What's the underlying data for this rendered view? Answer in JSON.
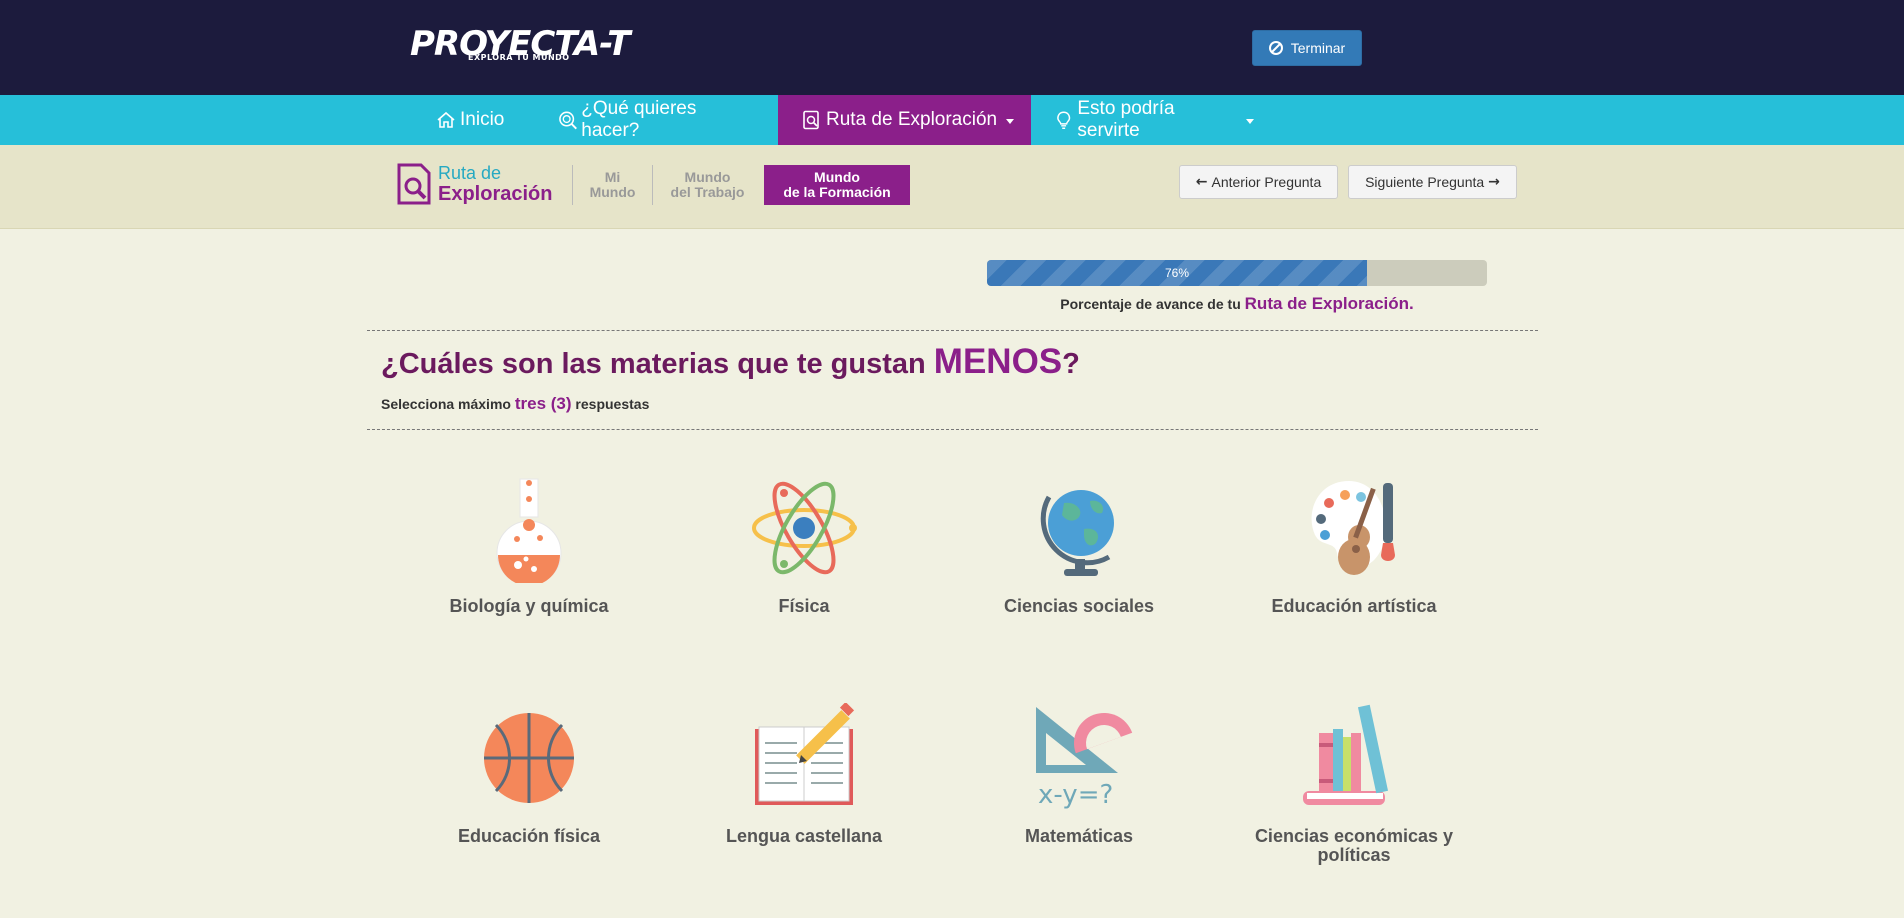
{
  "header": {
    "brand": "PROYECTA-T",
    "tagline": "EXPLORA TU MUNDO",
    "finish_button": "Terminar"
  },
  "nav": {
    "items": [
      {
        "label": "Inicio",
        "icon": "home-icon"
      },
      {
        "label": "¿Qué quieres hacer?",
        "icon": "search-target-icon"
      },
      {
        "label": "Ruta de Exploración",
        "icon": "document-search-icon",
        "active": true,
        "dropdown": true
      },
      {
        "label": "Esto podría servirte",
        "icon": "lightbulb-icon",
        "dropdown": true
      }
    ]
  },
  "subnav": {
    "ruta_line1": "Ruta de",
    "ruta_line2": "Exploración",
    "steps": [
      {
        "line1": "Mi",
        "line2": "Mundo"
      },
      {
        "line1": "Mundo",
        "line2": "del Trabajo"
      },
      {
        "line1": "Mundo",
        "line2": "de la Formación",
        "active": true
      }
    ],
    "prev_button": "Anterior Pregunta",
    "next_button": "Siguiente Pregunta"
  },
  "progress": {
    "value_percent": 76,
    "label": "76%",
    "caption": "Porcentaje de avance de tu",
    "caption_highlight": "Ruta de Exploración."
  },
  "question": {
    "text": "¿Cuáles son las materias que te gustan",
    "emphasis": "MENOS",
    "end": "?",
    "hint_pre": "Selecciona máximo",
    "hint_em": "tres (3)",
    "hint_post": "respuestas"
  },
  "options": [
    {
      "label": "Biología y química",
      "icon": "flask-icon"
    },
    {
      "label": "Física",
      "icon": "atom-icon"
    },
    {
      "label": "Ciencias sociales",
      "icon": "globe-icon"
    },
    {
      "label": "Educación artística",
      "icon": "art-palette-guitar-icon"
    },
    {
      "label": "Educación física",
      "icon": "basketball-icon"
    },
    {
      "label": "Lengua castellana",
      "icon": "book-pencil-icon"
    },
    {
      "label": "Matemáticas",
      "icon": "set-square-protractor-icon"
    },
    {
      "label": "Ciencias económicas y políticas",
      "icon": "books-icon"
    }
  ],
  "colors": {
    "header_bg": "#1c1b3d",
    "nav_bg": "#26bfd9",
    "accent_purple": "#8b1f8a",
    "page_bg": "#f1f1e2",
    "progress_fill": "#3a78b8"
  }
}
